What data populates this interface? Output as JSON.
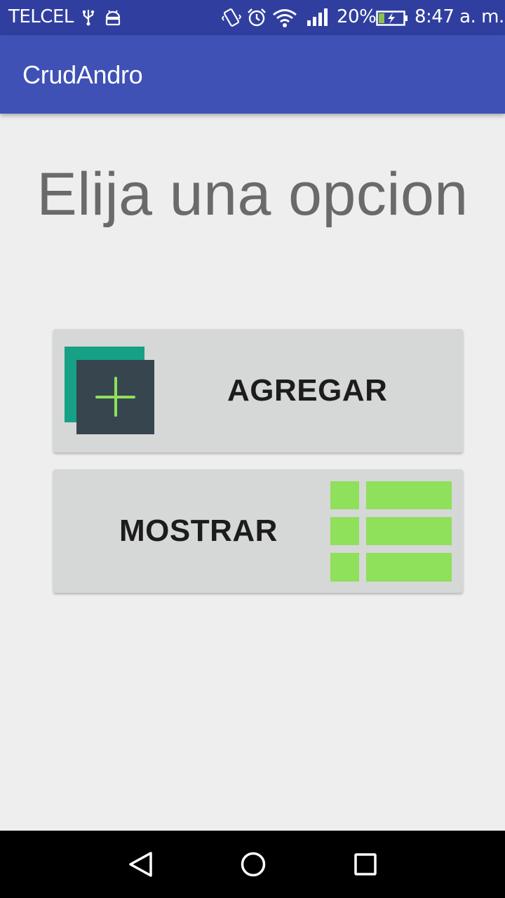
{
  "status_bar": {
    "carrier": "TELCEL",
    "battery_percent": "20%",
    "time": "8:47 a. m.",
    "icons": [
      "usb-icon",
      "android-debug-icon",
      "vibrate-icon",
      "alarm-icon",
      "wifi-icon",
      "signal-icon",
      "battery-charging-icon"
    ]
  },
  "app_bar": {
    "title": "CrudAndro"
  },
  "main": {
    "heading": "Elija una opcion",
    "buttons": {
      "add_label": "AGREGAR",
      "show_label": "MOSTRAR"
    }
  },
  "nav_bar": {
    "icons": [
      "back-icon",
      "home-icon",
      "recent-apps-icon"
    ]
  },
  "colors": {
    "status_bar": "#303f9f",
    "app_bar": "#3f51b5",
    "background": "#eeeeee",
    "button": "#d6d7d7",
    "accent_green": "#8fe05b",
    "teal": "#16a085",
    "dark_slate": "#37454f"
  }
}
